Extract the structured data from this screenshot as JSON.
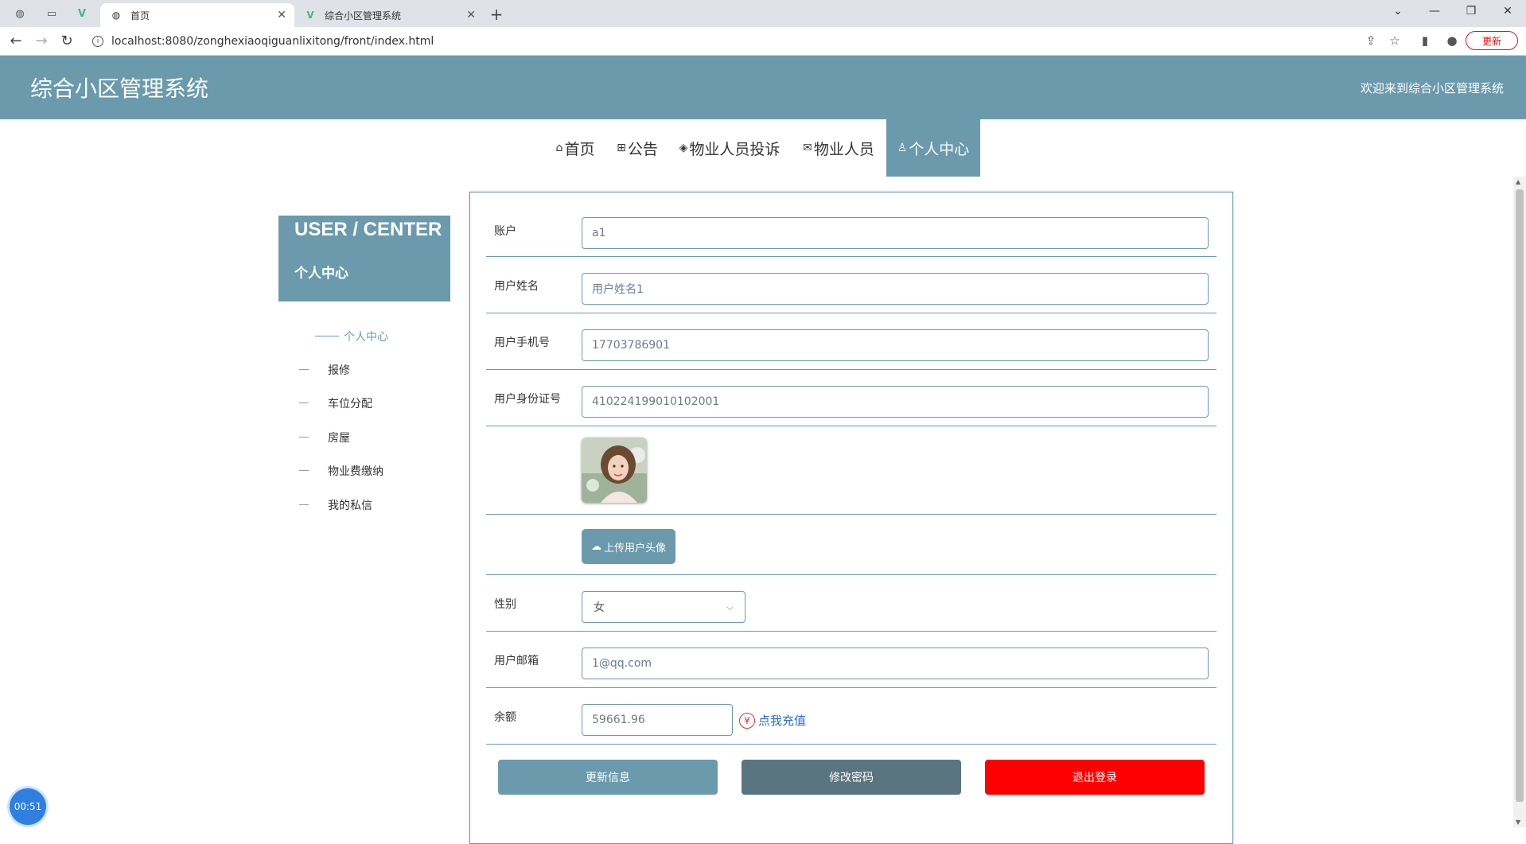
{
  "browser": {
    "tabs": [
      {
        "title": "首页",
        "active": true
      },
      {
        "title": "综合小区管理系统",
        "active": false
      }
    ],
    "url": "localhost:8080/zonghexiaoqiguanlixitong/front/index.html",
    "update_label": "更新"
  },
  "header": {
    "title": "综合小区管理系统",
    "welcome": "欢迎来到综合小区管理系统",
    "bg_color": "#6a9aac"
  },
  "nav": {
    "items": [
      {
        "icon": "home-icon",
        "label": "首页"
      },
      {
        "icon": "grid-icon",
        "label": "公告"
      },
      {
        "icon": "hat-icon",
        "label": "物业人员投诉"
      },
      {
        "icon": "mail-icon",
        "label": "物业人员"
      },
      {
        "icon": "user-icon",
        "label": "个人中心",
        "active": true
      }
    ]
  },
  "sidebar": {
    "title_en": "USER / CENTER",
    "title_cn": "个人中心",
    "items": [
      {
        "label": "个人中心",
        "active": true
      },
      {
        "label": "报修"
      },
      {
        "label": "车位分配"
      },
      {
        "label": "房屋"
      },
      {
        "label": "物业费缴纳"
      },
      {
        "label": "我的私信"
      }
    ]
  },
  "form": {
    "account": {
      "label": "账户",
      "value": "a1"
    },
    "name": {
      "label": "用户姓名",
      "value": "用户姓名1"
    },
    "phone": {
      "label": "用户手机号",
      "value": "17703786901"
    },
    "id_card": {
      "label": "用户身份证号",
      "value": "410224199010102001"
    },
    "upload_label": "上传用户头像",
    "gender": {
      "label": "性别",
      "value": "女"
    },
    "email": {
      "label": "用户邮箱",
      "value": "1@qq.com"
    },
    "balance": {
      "label": "余额",
      "value": "59661.96",
      "recharge_label": "点我充值"
    },
    "buttons": {
      "update": "更新信息",
      "change_password": "修改密码",
      "logout": "退出登录"
    }
  },
  "timer": "00:51",
  "colors": {
    "accent": "#6a9aac",
    "dark_button": "#5a7580",
    "logout": "#ff0000",
    "link": "#2a6ad0"
  }
}
